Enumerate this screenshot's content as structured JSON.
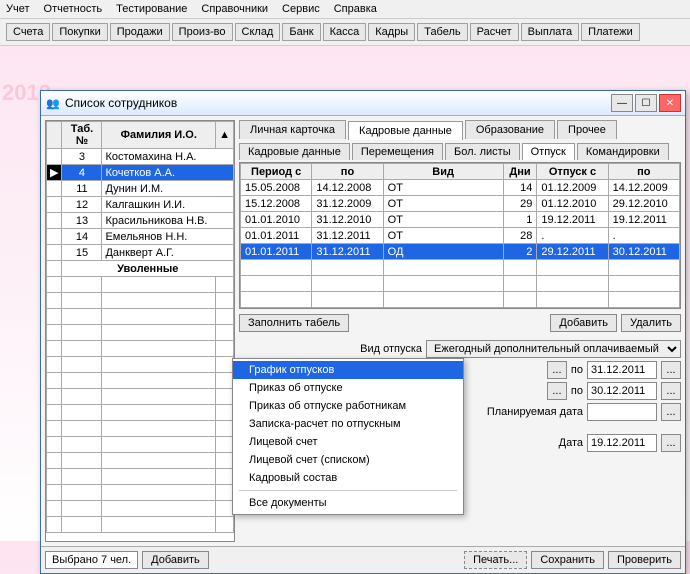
{
  "menubar": [
    "Учет",
    "Отчетность",
    "Тестирование",
    "Справочники",
    "Сервис",
    "Справка"
  ],
  "toolbar": [
    "Счета",
    "Покупки",
    "Продажи",
    "Произ-во",
    "Склад",
    "Банк",
    "Касса",
    "Кадры",
    "Табель",
    "Расчет",
    "Выплата",
    "Платежи"
  ],
  "bg_year": "2010",
  "window": {
    "title": "Список сотрудников",
    "employees": {
      "headers": {
        "tab": "Таб.№",
        "fio": "Фамилия И.О.",
        "arrow": "▲"
      },
      "rows": [
        {
          "tab": "3",
          "fio": "Костомахина Н.А.",
          "sel": false
        },
        {
          "tab": "4",
          "fio": "Кочетков А.А.",
          "sel": true
        },
        {
          "tab": "11",
          "fio": "Дунин И.М.",
          "sel": false
        },
        {
          "tab": "12",
          "fio": "Калгашкин И.И.",
          "sel": false
        },
        {
          "tab": "13",
          "fio": "Красильникова Н.В.",
          "sel": false
        },
        {
          "tab": "14",
          "fio": "Емельянов Н.Н.",
          "sel": false
        },
        {
          "tab": "15",
          "fio": "Данкверт А.Г.",
          "sel": false
        }
      ],
      "group_label": "Уволенные",
      "selected_status": "Выбрано 7 чел.",
      "add_button": "Добавить"
    },
    "tabs": {
      "main": [
        "Личная карточка",
        "Кадровые данные",
        "Образование",
        "Прочее"
      ],
      "main_active": 1,
      "sub": [
        "Кадровые данные",
        "Перемещения",
        "Бол. листы",
        "Отпуск",
        "Командировки"
      ],
      "sub_active": 3
    },
    "vacations": {
      "headers": [
        "Период с",
        "по",
        "Вид",
        "Дни",
        "Отпуск с",
        "по"
      ],
      "rows": [
        {
          "from": "15.05.2008",
          "to": "14.12.2008",
          "kind": "ОТ",
          "days": "14",
          "vfrom": "01.12.2009",
          "vto": "14.12.2009",
          "sel": false
        },
        {
          "from": "15.12.2008",
          "to": "31.12.2009",
          "kind": "ОТ",
          "days": "29",
          "vfrom": "01.12.2010",
          "vto": "29.12.2010",
          "sel": false
        },
        {
          "from": "01.01.2010",
          "to": "31.12.2010",
          "kind": "ОТ",
          "days": "1",
          "vfrom": "19.12.2011",
          "vto": "19.12.2011",
          "sel": false
        },
        {
          "from": "01.01.2011",
          "to": "31.12.2011",
          "kind": "ОТ",
          "days": "28",
          "vfrom": ".",
          "vto": ".",
          "sel": false
        },
        {
          "from": "01.01.2011",
          "to": "31.12.2011",
          "kind": "ОД",
          "days": "2",
          "vfrom": "29.12.2011",
          "vto": "30.12.2011",
          "sel": true
        }
      ],
      "fill_tabel": "Заполнить табель",
      "add": "Добавить",
      "delete": "Удалить"
    },
    "form": {
      "type_label": "Вид отпуска",
      "type_value": "Ежегодный дополнительный оплачиваемый о",
      "po1_label": "по",
      "po1_value": "31.12.2011",
      "po2_label": "по",
      "po2_value": "30.12.2011",
      "plan_label": "Планируемая дата",
      "plan_value": "",
      "date_label": "Дата",
      "date_value": "19.12.2011",
      "dots": "..."
    },
    "bottom": {
      "print": "Печать...",
      "save": "Сохранить",
      "check": "Проверить"
    }
  },
  "context_menu": {
    "items": [
      {
        "label": "График отпусков",
        "hl": true
      },
      {
        "label": "Приказ об отпуске",
        "hl": false
      },
      {
        "label": "Приказ об отпуске работникам",
        "hl": false
      },
      {
        "label": "Записка-расчет по отпускным",
        "hl": false
      },
      {
        "label": "Лицевой счет",
        "hl": false
      },
      {
        "label": "Лицевой счет (списком)",
        "hl": false
      },
      {
        "label": "Кадровый состав",
        "hl": false
      }
    ],
    "all": "Все документы"
  }
}
